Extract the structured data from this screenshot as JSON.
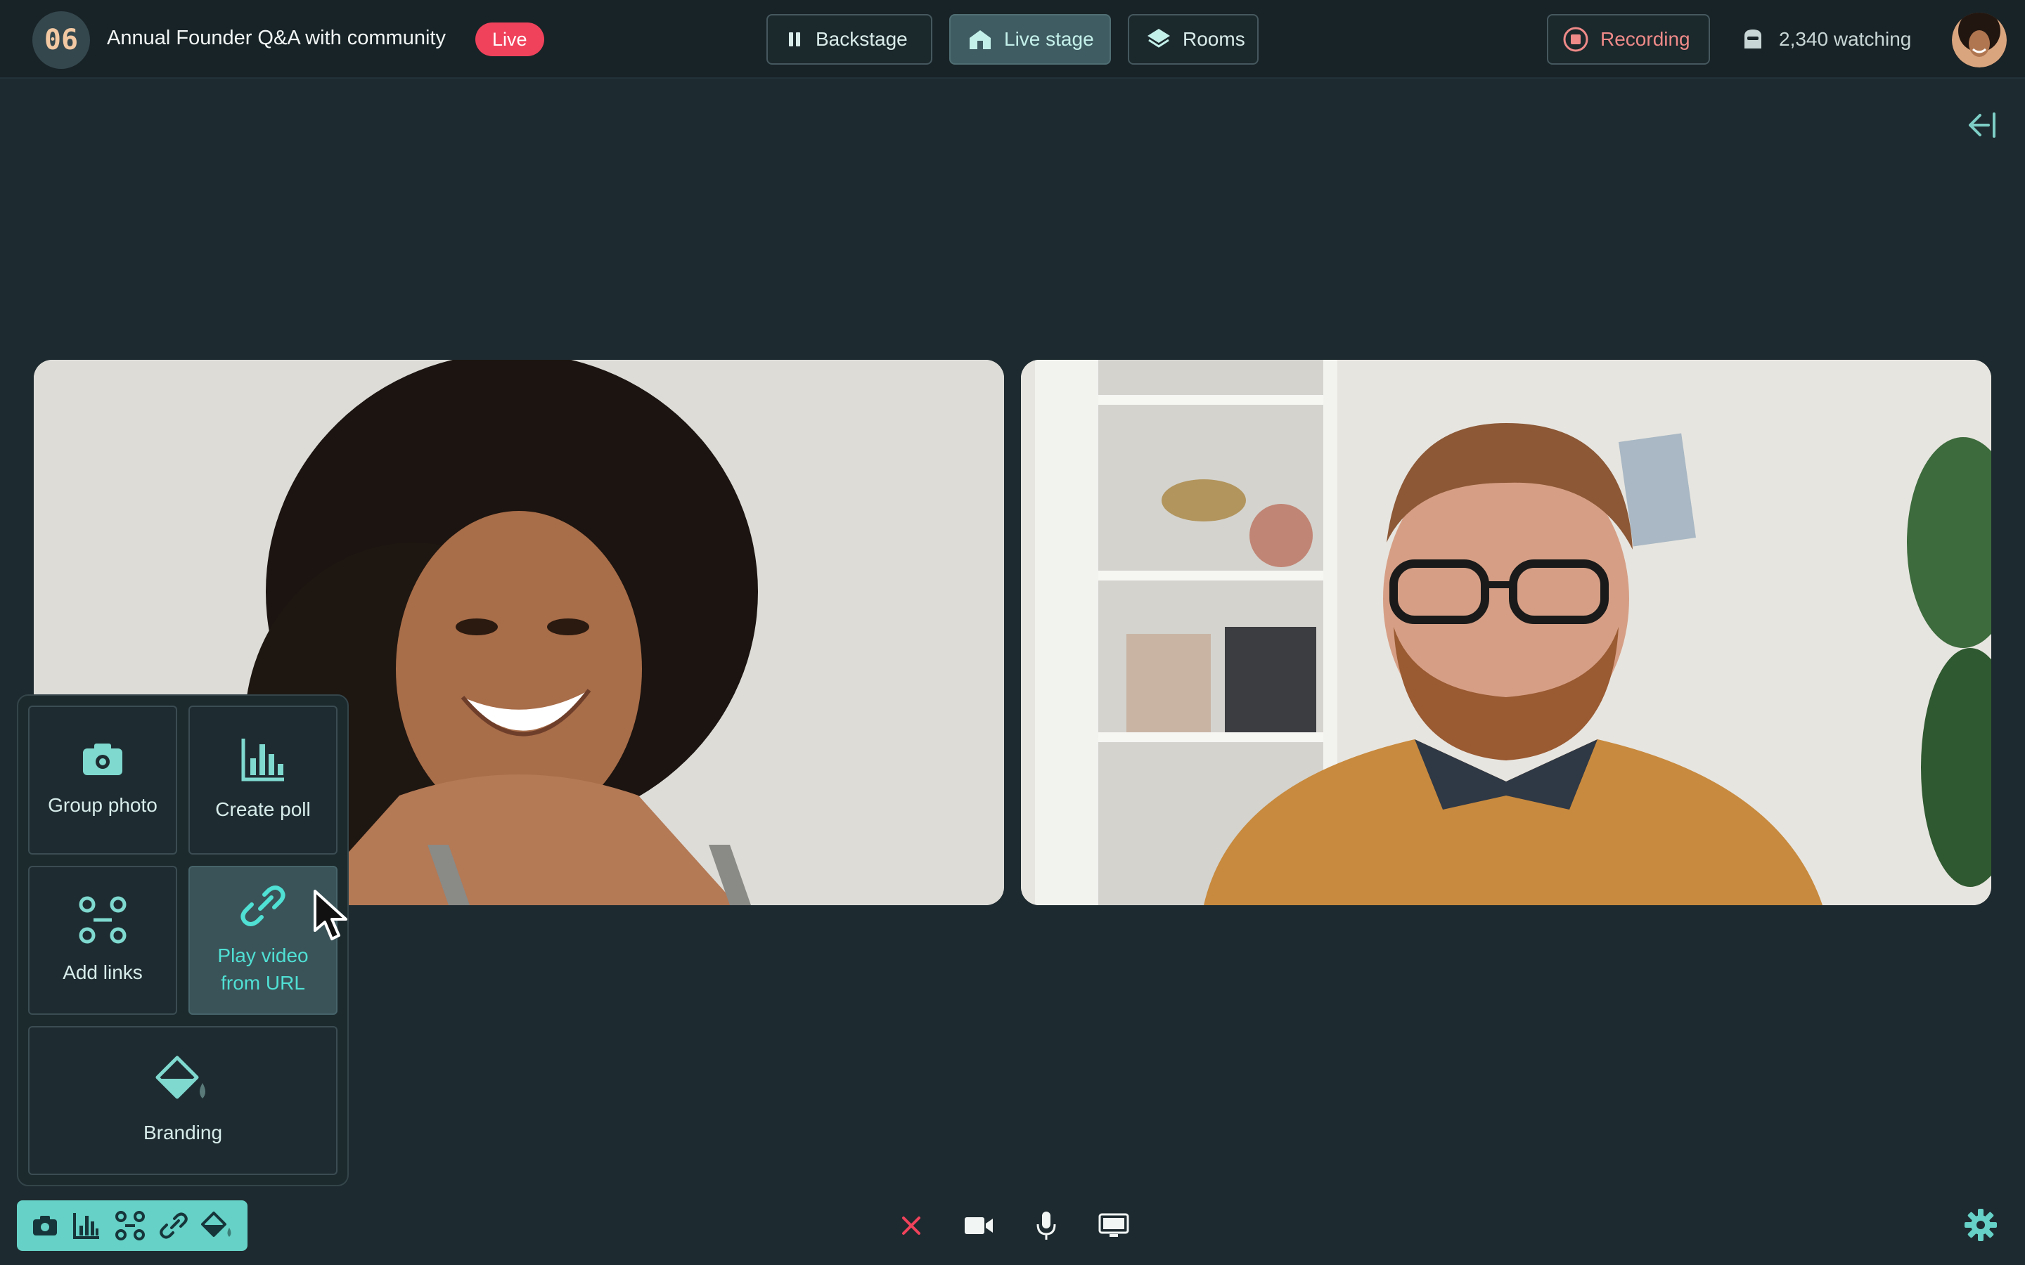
{
  "header": {
    "logo_text": "06",
    "event_title": "Annual Founder Q&A with community",
    "live_label": "Live",
    "nav": [
      {
        "label": "Backstage",
        "icon": "pause-icon",
        "active": false
      },
      {
        "label": "Live stage",
        "icon": "home-icon",
        "active": true
      },
      {
        "label": "Rooms",
        "icon": "layers-icon",
        "active": false
      }
    ],
    "recording_label": "Recording",
    "watching_label": "2,340 watching"
  },
  "panel": {
    "items": [
      {
        "label": "Group photo",
        "icon": "camera-icon"
      },
      {
        "label": "Create poll",
        "icon": "bar-chart-icon"
      },
      {
        "label": "Add links",
        "icon": "nodes-icon"
      },
      {
        "label": "Play video\nfrom URL",
        "icon": "link-icon",
        "active": true
      },
      {
        "label": "Branding",
        "icon": "paint-bucket-icon"
      }
    ]
  },
  "controls": [
    "leave-icon",
    "camera-icon",
    "microphone-icon",
    "screen-share-icon"
  ],
  "colors": {
    "background": "#1d2a2f",
    "accent": "#66d1c6",
    "live": "#f0425b",
    "recording": "#ee8a88",
    "active_text": "#50e0d4"
  }
}
